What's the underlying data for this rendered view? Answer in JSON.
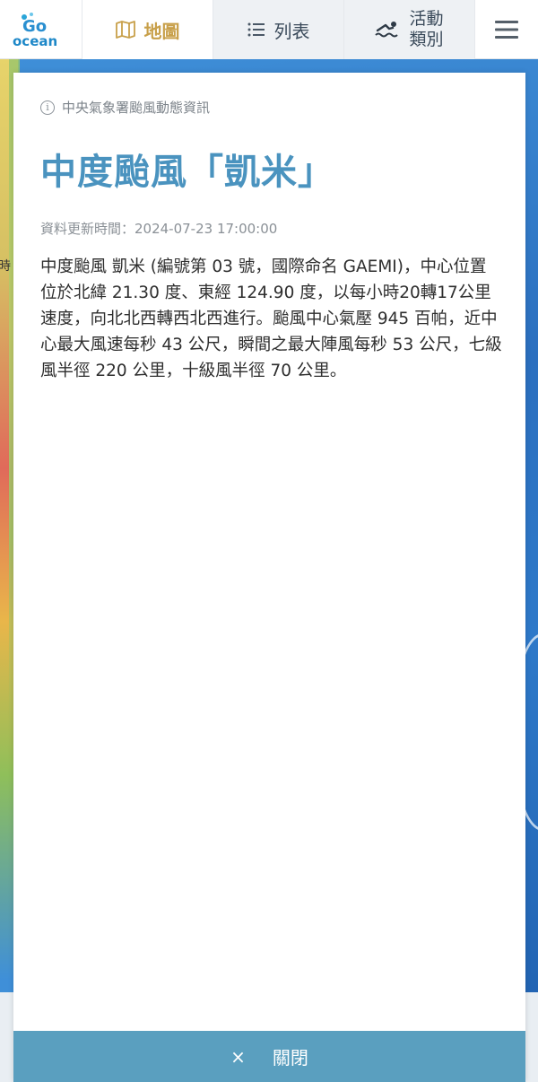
{
  "header": {
    "tabs": [
      {
        "label": "地圖",
        "icon": "map-icon",
        "active": true
      },
      {
        "label": "列表",
        "icon": "list-icon"
      },
      {
        "label_line1": "活動",
        "label_line2": "類別",
        "icon": "swimmer-icon"
      }
    ],
    "accent": "#c8a04a"
  },
  "map": {
    "edge_text": "時"
  },
  "panel": {
    "source": "中央氣象署颱風動態資訊",
    "title": "中度颱風「凱米」",
    "updated": "資料更新時間：2024-07-23 17:00:00",
    "body": "中度颱風 凱米 (編號第 03 號，國際命名 GAEMI)，中心位置位於北緯 21.30 度、東經 124.90 度，以每小時20轉17公里速度，向北北西轉西北西進行。颱風中心氣壓 945 百帕，近中心最大風速每秒 43 公尺，瞬間之最大陣風每秒 53 公尺，七級風半徑 220 公里，十級風半徑 70 公里。",
    "title_color": "#4a93bf"
  },
  "close_bar": {
    "x": "×",
    "label": "關閉",
    "color": "#5a9fbf"
  }
}
